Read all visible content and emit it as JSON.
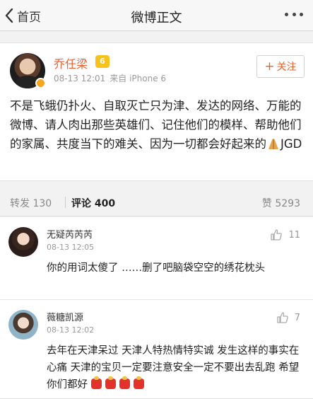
{
  "nav": {
    "back_label": "首页",
    "title": "微博正文"
  },
  "post": {
    "author": "乔任梁",
    "vip_label": "6",
    "time": "08-13 12:01",
    "source": "来自 iPhone 6",
    "follow_label": "关注",
    "text": "不是飞蛾仍扑火、自取灭亡只为津、发达的网络、万能的微博、请人肉出那些英雄们、记住他们的模样、帮助他们的家属、共度当下的难关、因为一切都会好起来的",
    "text_suffix": "JGD"
  },
  "stats": {
    "repost": "转发 130",
    "comment": "评论 400",
    "like": "赞 5293"
  },
  "comments": [
    {
      "name": "无疑芮芮芮",
      "time": "08-13 12:05",
      "likes": "11",
      "text": "你的用词太傻了 ……删了吧脑袋空空的绣花枕头"
    },
    {
      "name": "薇糖凯源",
      "time": "08-13 12:02",
      "likes": "7",
      "text": "去年在天津呆过 天津人特热情特实诚 发生这样的事实在心痛 天津的宝贝一定要注意安全一定不要出去乱跑 希望你们都好"
    }
  ],
  "colors": {
    "accent": "#e8622f",
    "background": "#f2f2f2"
  }
}
